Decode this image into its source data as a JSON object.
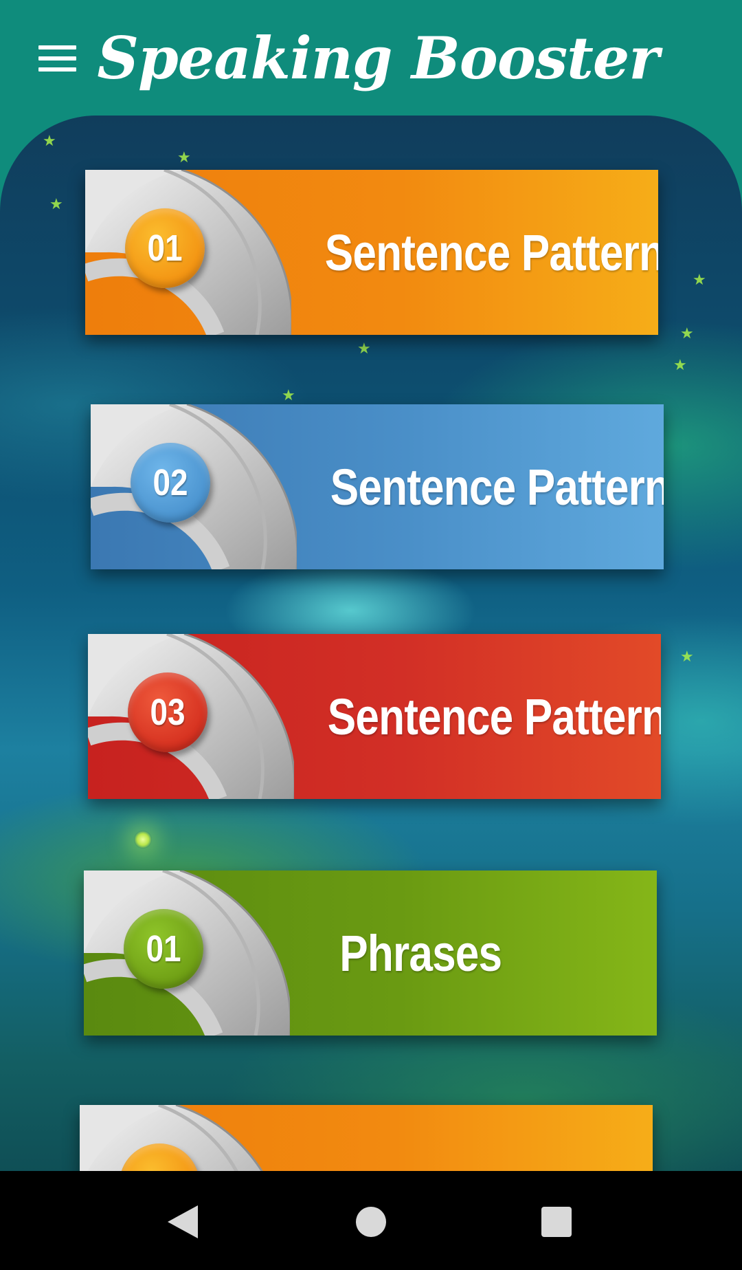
{
  "app": {
    "title": "Speaking Booster"
  },
  "colors": {
    "appbar": "#0f8c7c",
    "orange": "#f28a10",
    "blue": "#4a8fc8",
    "red": "#d22f26",
    "green": "#6a9a12"
  },
  "cards": [
    {
      "number": "01",
      "label": "Sentence Patterns",
      "color": "orange"
    },
    {
      "number": "02",
      "label": "Sentence Patterns",
      "color": "blue"
    },
    {
      "number": "03",
      "label": "Sentence Patterns",
      "color": "red"
    },
    {
      "number": "01",
      "label": "Phrases",
      "color": "green"
    },
    {
      "number": "",
      "label": "",
      "color": "orange"
    }
  ],
  "icons": {
    "menu": "menu-icon",
    "back": "back-triangle-icon",
    "home": "home-circle-icon",
    "recents": "recents-square-icon"
  }
}
